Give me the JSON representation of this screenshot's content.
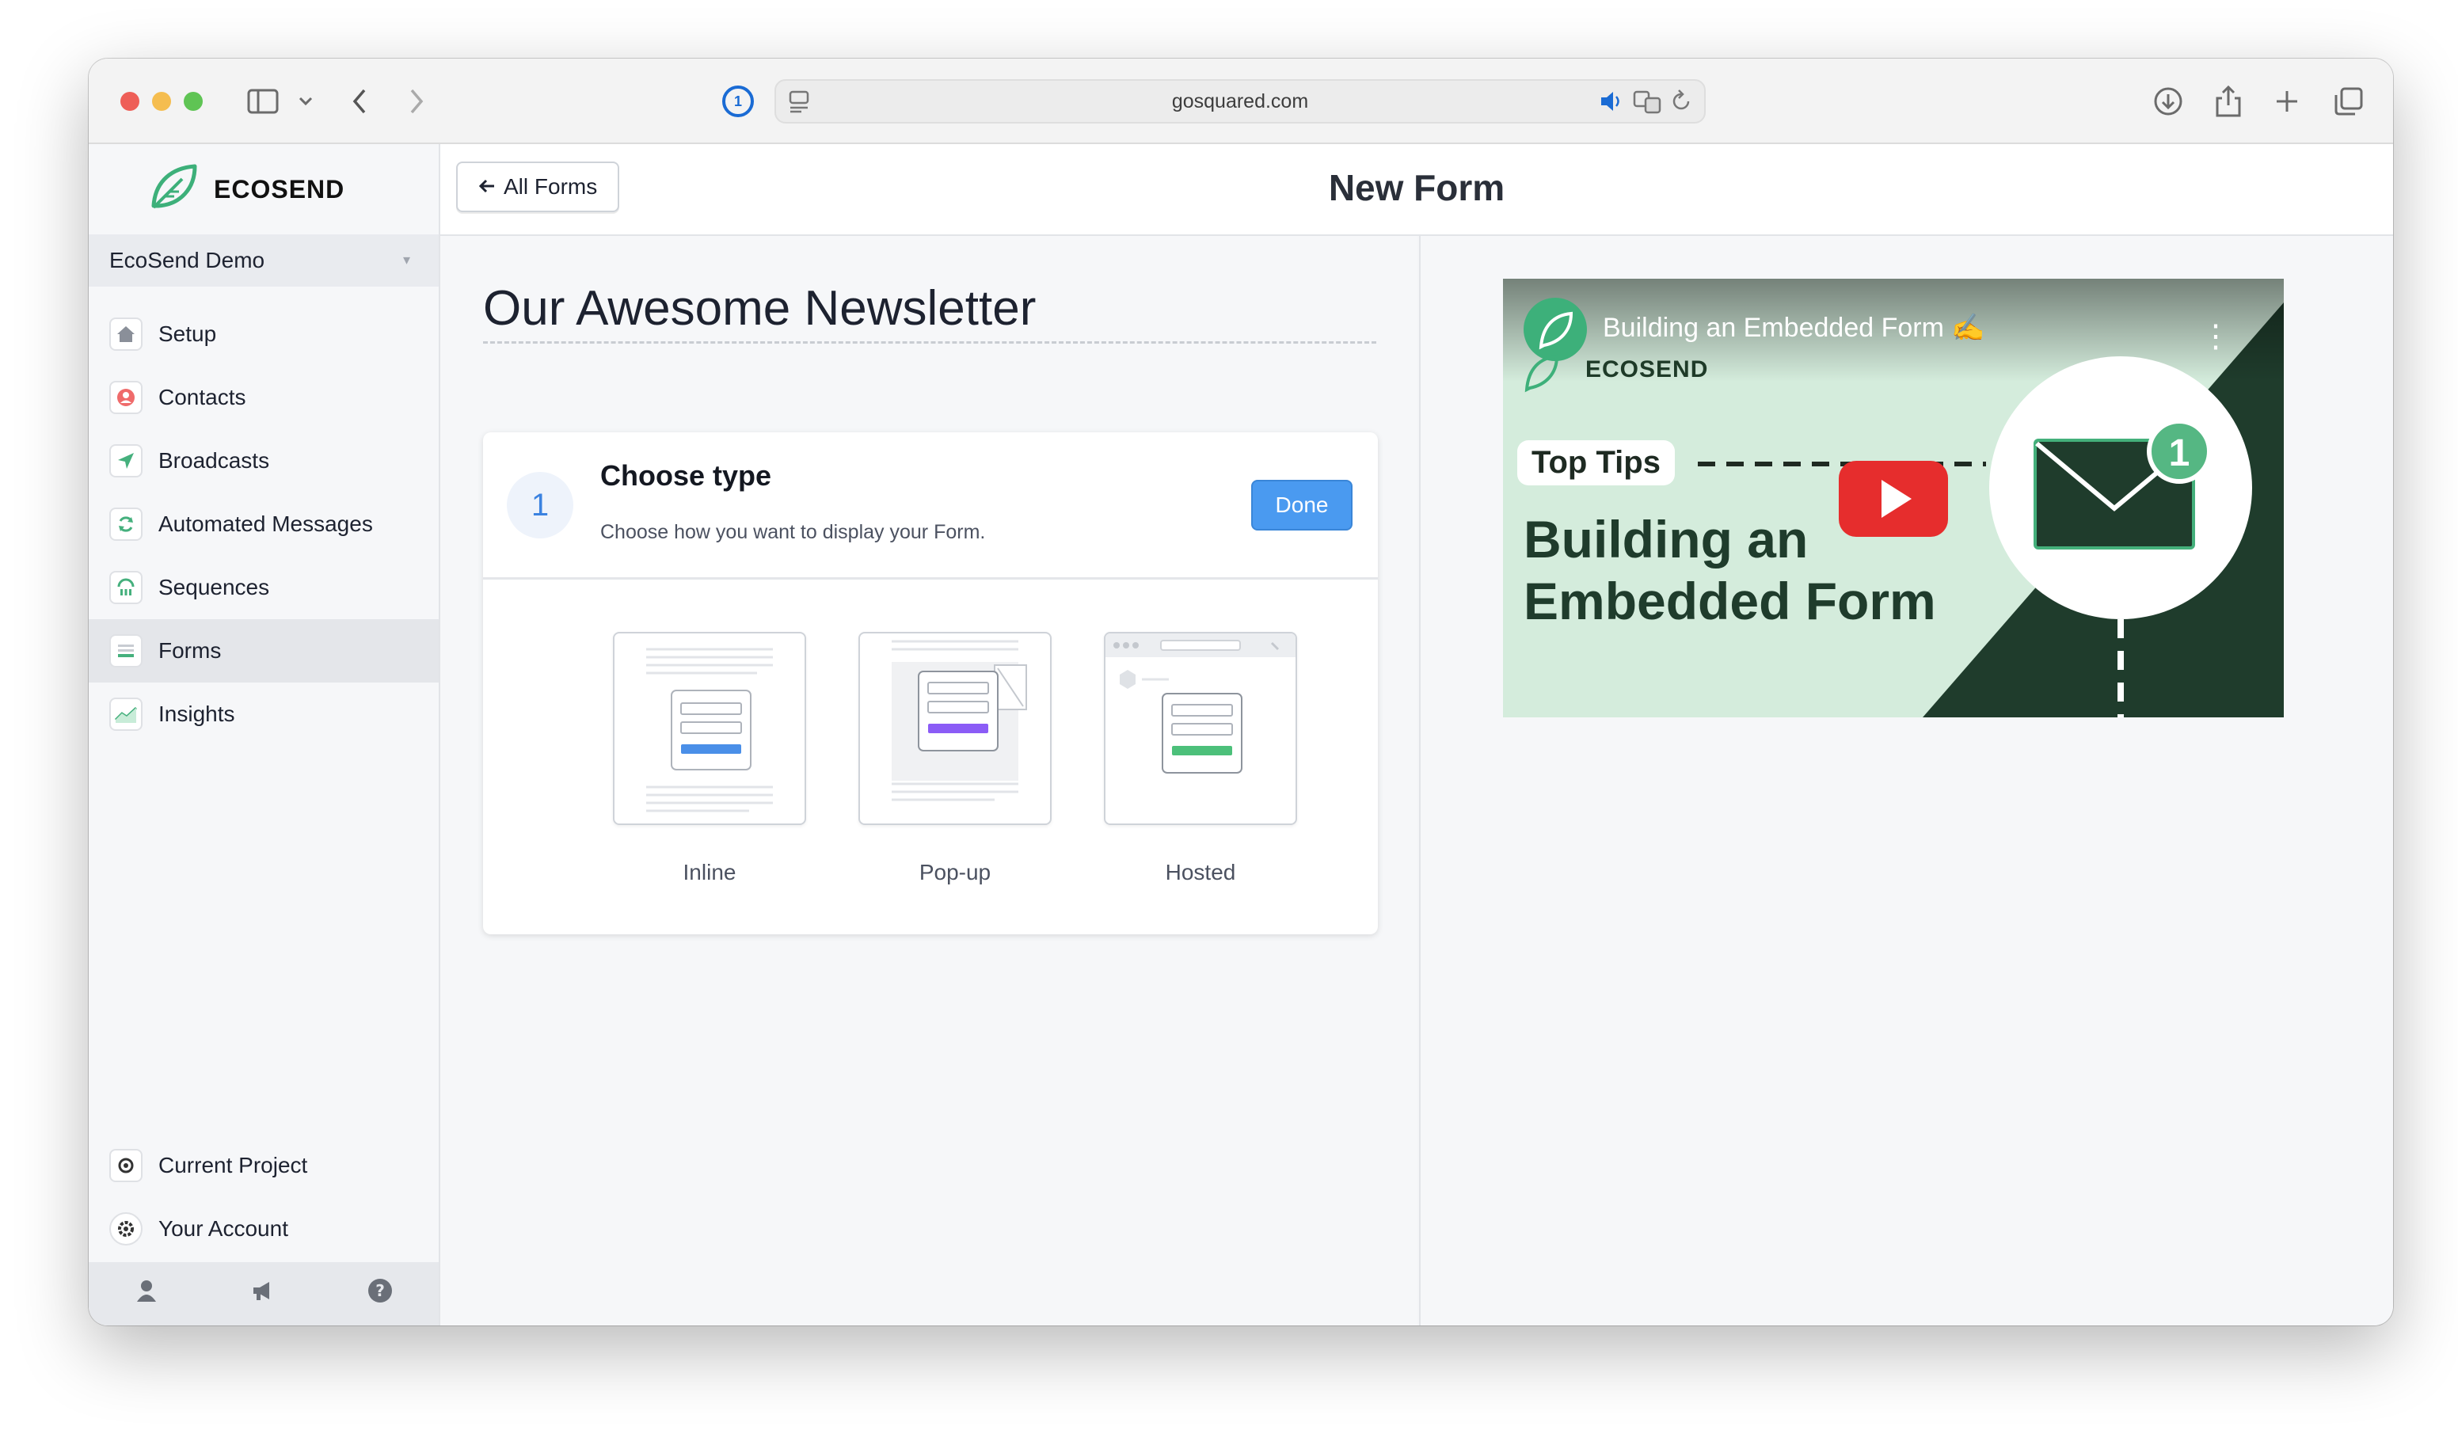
{
  "browser": {
    "url": "gosquared.com"
  },
  "sidebar": {
    "brand": "ECOSEND",
    "project": "EcoSend Demo",
    "items": [
      {
        "label": "Setup",
        "icon": "house-icon"
      },
      {
        "label": "Contacts",
        "icon": "person-icon"
      },
      {
        "label": "Broadcasts",
        "icon": "send-icon"
      },
      {
        "label": "Automated Messages",
        "icon": "refresh-icon"
      },
      {
        "label": "Sequences",
        "icon": "sequence-icon"
      },
      {
        "label": "Forms",
        "icon": "form-icon"
      },
      {
        "label": "Insights",
        "icon": "chart-icon"
      }
    ],
    "bottom_items": [
      {
        "label": "Current Project",
        "icon": "project-icon"
      },
      {
        "label": "Your Account",
        "icon": "gear-icon"
      }
    ]
  },
  "header": {
    "back_label": "All Forms",
    "title": "New Form"
  },
  "form": {
    "name": "Our Awesome Newsletter",
    "step": {
      "number": "1",
      "title": "Choose type",
      "subtitle": "Choose how you want to display your Form.",
      "done_label": "Done"
    },
    "types": [
      {
        "label": "Inline",
        "accent": "#4a8fe8"
      },
      {
        "label": "Pop-up",
        "accent": "#8b5cf6"
      },
      {
        "label": "Hosted",
        "accent": "#4cc07a"
      }
    ]
  },
  "video": {
    "title": "Building an Embedded Form ✍️",
    "brand": "ECOSEND",
    "tag": "Top Tips",
    "headline_line1": "Building an",
    "headline_line2": "Embedded Form",
    "badge": "1"
  },
  "colors": {
    "primary": "#4a9af0",
    "brand_green": "#3db07a",
    "video_dark": "#1f3c2c",
    "video_light": "#d4ecdc"
  }
}
